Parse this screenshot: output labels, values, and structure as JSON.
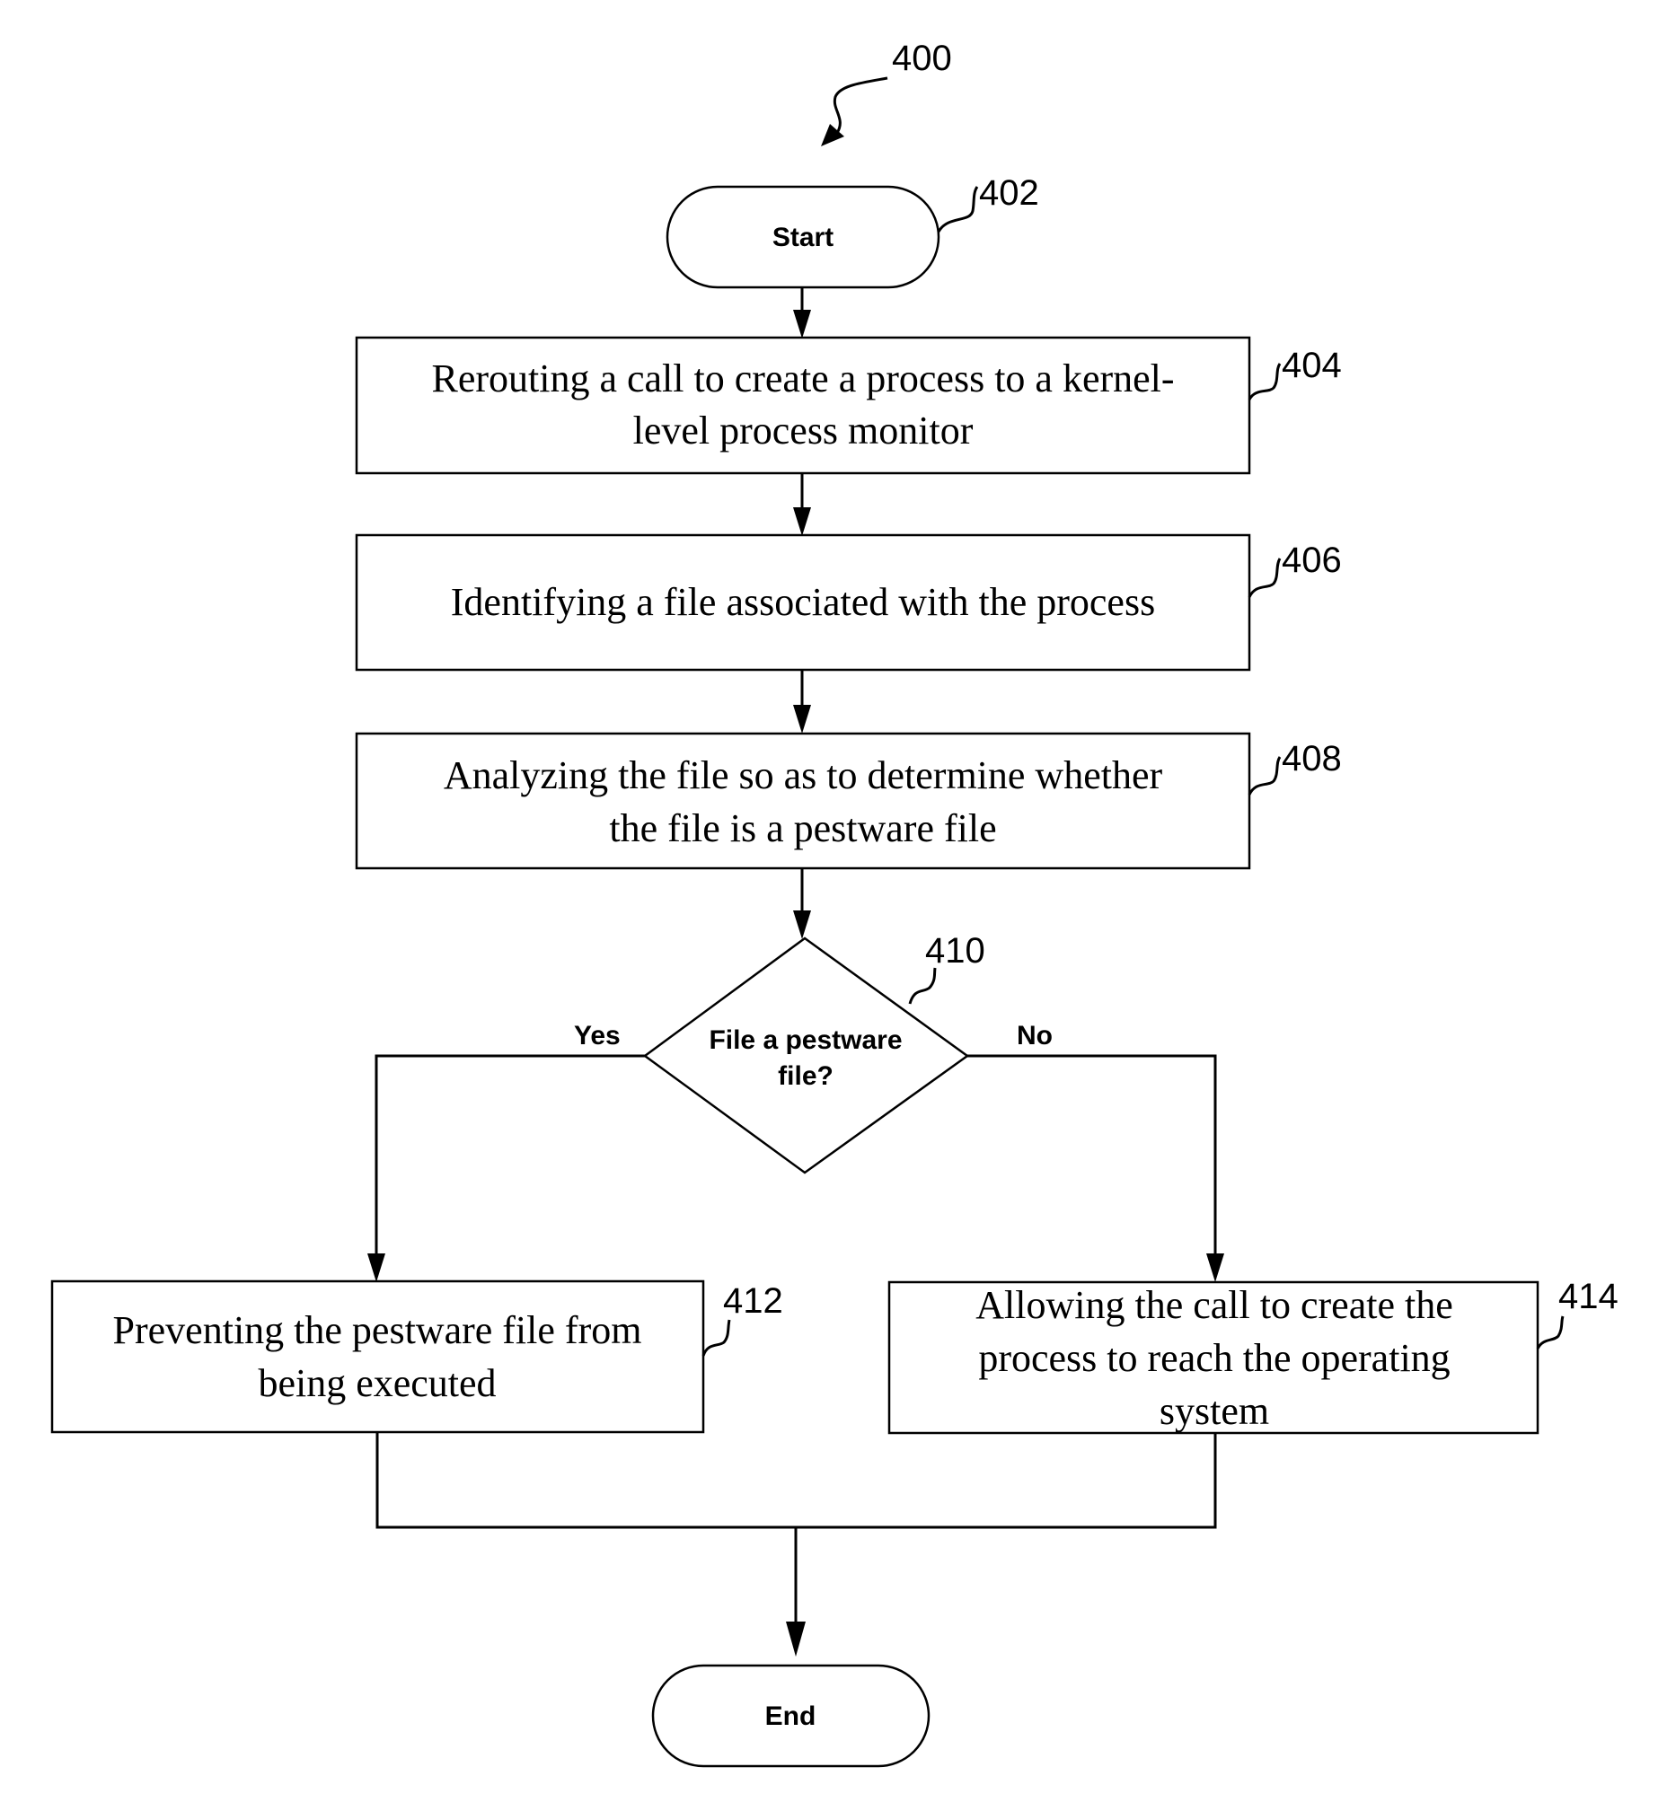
{
  "figure": {
    "reference": "400",
    "start": {
      "ref": "402",
      "label": "Start"
    },
    "steps": [
      {
        "ref": "404",
        "lines": [
          "Rerouting a call to create a process to a kernel-",
          "level process monitor"
        ]
      },
      {
        "ref": "406",
        "lines": [
          "Identifying a file associated with the process"
        ]
      },
      {
        "ref": "408",
        "lines": [
          "Analyzing the file so as to determine whether",
          "the file is a pestware file"
        ]
      }
    ],
    "decision": {
      "ref": "410",
      "lines": [
        "File a pestware",
        "file?"
      ],
      "yes_label": "Yes",
      "no_label": "No"
    },
    "yes_step": {
      "ref": "412",
      "lines": [
        "Preventing the pestware file from",
        "being executed"
      ]
    },
    "no_step": {
      "ref": "414",
      "lines": [
        "Allowing the call to create the",
        "process to reach the operating",
        "system"
      ]
    },
    "end": {
      "label": "End"
    }
  }
}
